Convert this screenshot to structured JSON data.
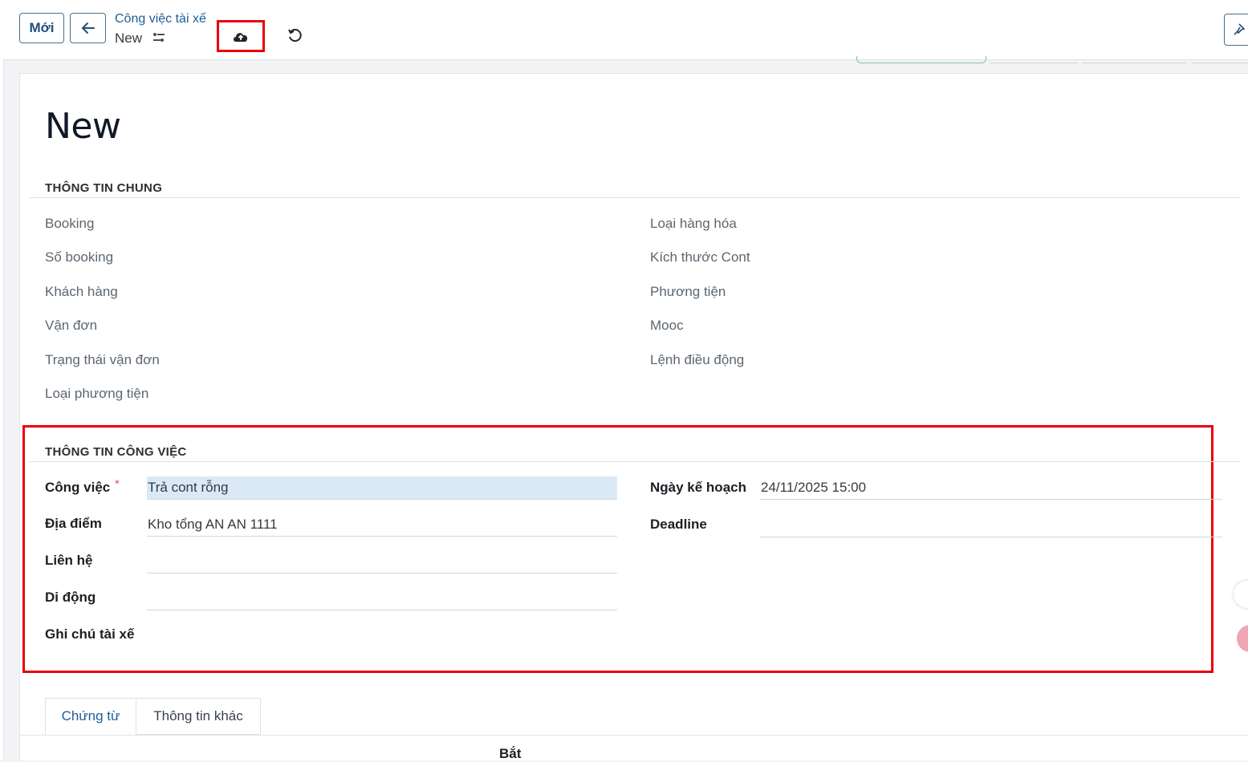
{
  "control_panel": {
    "new_button": "Mới",
    "breadcrumb_parent": "Công việc tài xế",
    "breadcrumb_current": "New"
  },
  "form": {
    "title": "New",
    "section_general": {
      "title": "THÔNG TIN CHUNG",
      "left_labels": [
        "Booking",
        "Số booking",
        "Khách hàng",
        "Vận đơn",
        "Trạng thái vận đơn",
        "Loại phương tiện"
      ],
      "right_labels": [
        "Loại hàng hóa",
        "Kích thước Cont",
        "Phương tiện",
        "Mooc",
        "Lệnh điều động"
      ]
    },
    "section_job": {
      "title": "THÔNG TIN CÔNG VIỆC",
      "cong_viec_label": "Công việc",
      "cong_viec_required": "*",
      "cong_viec_value": "Trả cont rỗng",
      "dia_diem_label": "Địa điểm",
      "dia_diem_value": "Kho tổng AN AN 1111",
      "lien_he_label": "Liên hệ",
      "lien_he_value": "",
      "di_dong_label": "Di động",
      "di_dong_value": "",
      "ghi_chu_label": "Ghi chú tài xế",
      "ngay_ke_hoach_label": "Ngày kế hoạch",
      "ngay_ke_hoach_value": "24/11/2025 15:00",
      "deadline_label": "Deadline",
      "deadline_value": ""
    },
    "tabs": [
      "Chứng từ",
      "Thông tin khác"
    ],
    "table_header": "Bắt"
  },
  "colors": {
    "accent": "#1f5d96",
    "highlight": "#e8000b",
    "focus_bg": "#dbe9f7"
  }
}
